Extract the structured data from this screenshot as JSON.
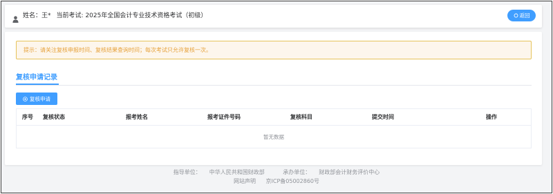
{
  "header": {
    "name_label": "姓名：",
    "name_value": "王*",
    "exam_label": "当前考试:",
    "exam_value": "2025年全国会计专业技术资格考试（初级）",
    "back_label": "返回"
  },
  "notice": {
    "text": "提示：请关注复核申报时间、复核结果查询时间；每次考试只允许复核一次。"
  },
  "section": {
    "title": "复核申请记录"
  },
  "actions": {
    "apply_label": "复核申请"
  },
  "table": {
    "columns": [
      "序号",
      "复核状态",
      "报考姓名",
      "报考证件号码",
      "复核科目",
      "提交时间",
      "操作"
    ],
    "empty_text": "暂无数据"
  },
  "footer": {
    "guide_label": "指导单位：",
    "guide_value": "中华人民共和国财政部",
    "host_label": "承办单位：",
    "host_value": "财政部会计财务评价中心",
    "site_statement": "网站声明",
    "icp": "京ICP备05002860号"
  },
  "colors": {
    "primary": "#409eff",
    "warning_text": "#e6a23c",
    "warning_bg": "#fdf6ec",
    "warning_border": "#e6c35a"
  },
  "icons": {
    "user": "user-icon",
    "back": "refresh-icon",
    "apply": "plus-circle-icon"
  }
}
